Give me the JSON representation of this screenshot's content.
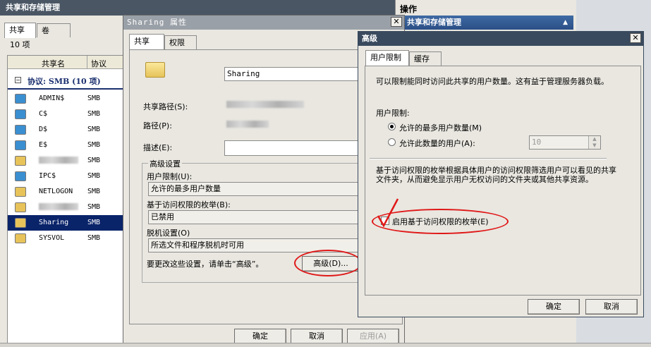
{
  "left_window": {
    "title": "共享和存储管理",
    "tabs": [
      "共享",
      "卷"
    ],
    "count": "10 项",
    "columns": [
      "共享名",
      "协议"
    ],
    "group_header": "协议: SMB (10 项)",
    "rows": [
      {
        "name": "ADMIN$",
        "protocol": "SMB"
      },
      {
        "name": "C$",
        "protocol": "SMB"
      },
      {
        "name": "D$",
        "protocol": "SMB"
      },
      {
        "name": "E$",
        "protocol": "SMB"
      },
      {
        "name": "",
        "protocol": "SMB"
      },
      {
        "name": "IPC$",
        "protocol": "SMB"
      },
      {
        "name": "NETLOGON",
        "protocol": "SMB"
      },
      {
        "name": "",
        "protocol": "SMB"
      },
      {
        "name": "Sharing",
        "protocol": "SMB"
      },
      {
        "name": "SYSVOL",
        "protocol": "SMB"
      }
    ]
  },
  "actions_pane": {
    "title": "操作",
    "section": "共享和存储管理"
  },
  "props_dialog": {
    "title": "Sharing 属性",
    "tabs": [
      "共享",
      "权限"
    ],
    "share_name": "Sharing",
    "share_path_label": "共享路径(S):",
    "path_label": "路径(P):",
    "desc_label": "描述(E):",
    "advanced_group": "高级设置",
    "user_limit_label": "用户限制(U):",
    "user_limit_value": "允许的最多用户数量",
    "abe_label": "基于访问权限的枚举(B):",
    "abe_value": "已禁用",
    "offline_label": "脱机设置(O)",
    "offline_value": "所选文件和程序脱机时可用",
    "hint": "要更改这些设置，请单击“高级”。",
    "advanced_btn": "高级(D)...",
    "ok": "确定",
    "cancel": "取消",
    "apply": "应用(A)"
  },
  "adv_dialog": {
    "title": "高级",
    "tabs": [
      "用户限制",
      "缓存"
    ],
    "desc1": "可以限制能同时访问此共享的用户数量。这有益于管理服务器负载。",
    "limit_group": "用户限制:",
    "opt_max": "允许的最多用户数量(M)",
    "opt_num": "允许此数量的用户(A):",
    "num_value": "10",
    "desc2": "基于访问权限的枚举根据具体用户的访问权限筛选用户可以看见的共享文件夹，从而避免显示用户无权访问的文件夹或其他共享资源。",
    "abe_checkbox": "启用基于访问权限的枚举(E)",
    "ok": "确定",
    "cancel": "取消"
  }
}
